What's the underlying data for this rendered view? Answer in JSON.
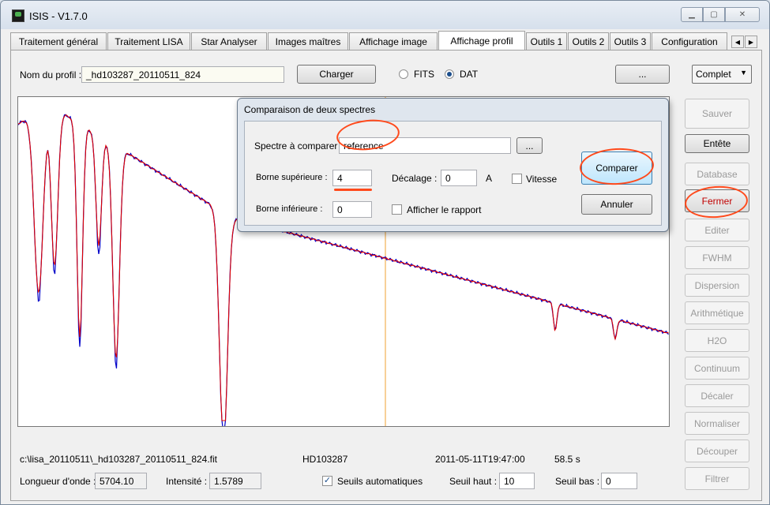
{
  "window": {
    "title": "ISIS - V1.7.0"
  },
  "tabs": [
    {
      "label": "Traitement général"
    },
    {
      "label": "Traitement LISA"
    },
    {
      "label": "Star Analyser"
    },
    {
      "label": "Images maîtres"
    },
    {
      "label": "Affichage image"
    },
    {
      "label": "Affichage profil"
    },
    {
      "label": "Outils 1"
    },
    {
      "label": "Outils 2"
    },
    {
      "label": "Outils 3"
    },
    {
      "label": "Configuration"
    }
  ],
  "profile": {
    "name_label": "Nom du profil :",
    "name_value": "_hd103287_20110511_824",
    "load_label": "Charger",
    "fits_label": "FITS",
    "dat_label": "DAT",
    "ellipsis_label": "...",
    "mode_value": "Complet"
  },
  "side_buttons": [
    {
      "label": "Sauver",
      "enabled": false
    },
    {
      "label": "Entête",
      "enabled": true
    },
    {
      "label": "Database",
      "enabled": false
    },
    {
      "label": "Fermer",
      "enabled": true
    },
    {
      "label": "Editer",
      "enabled": false
    },
    {
      "label": "FWHM",
      "enabled": false
    },
    {
      "label": "Dispersion",
      "enabled": false
    },
    {
      "label": "Arithmétique",
      "enabled": false
    },
    {
      "label": "H2O",
      "enabled": false
    },
    {
      "label": "Continuum",
      "enabled": false
    },
    {
      "label": "Décaler",
      "enabled": false
    },
    {
      "label": "Normaliser",
      "enabled": false
    },
    {
      "label": "Découper",
      "enabled": false
    },
    {
      "label": "Filtrer",
      "enabled": false
    }
  ],
  "dialog": {
    "title": "Comparaison de deux spectres",
    "compare_label": "Spectre à comparer :",
    "compare_value": "reference",
    "browse_label": "...",
    "upper_label": "Borne supérieure :",
    "upper_value": "4",
    "lower_label": "Borne inférieure :",
    "lower_value": "0",
    "offset_label": "Décalage :",
    "offset_value": "0",
    "offset_unit": "A",
    "speed_label": "Vitesse",
    "report_label": "Afficher le rapport",
    "compare_button": "Comparer",
    "cancel_button": "Annuler"
  },
  "status": {
    "file_path": "c:\\lisa_20110511\\_hd103287_20110511_824.fit",
    "object": "HD103287",
    "date": "2011-05-11T19:47:00",
    "exposure": "58.5 s",
    "wavelength_label": "Longueur d'onde :",
    "wavelength_value": "5704.10",
    "intensity_label": "Intensité :",
    "intensity_value": "1.5789",
    "auto_thresholds_label": "Seuils automatiques",
    "high_threshold_label": "Seuil haut :",
    "high_threshold_value": "10",
    "low_threshold_label": "Seuil bas :",
    "low_threshold_value": "0"
  },
  "colors": {
    "series_red": "#e00000",
    "series_blue": "#0000c8",
    "cursor": "#f0a030",
    "annotation": "#ff4a1c"
  }
}
